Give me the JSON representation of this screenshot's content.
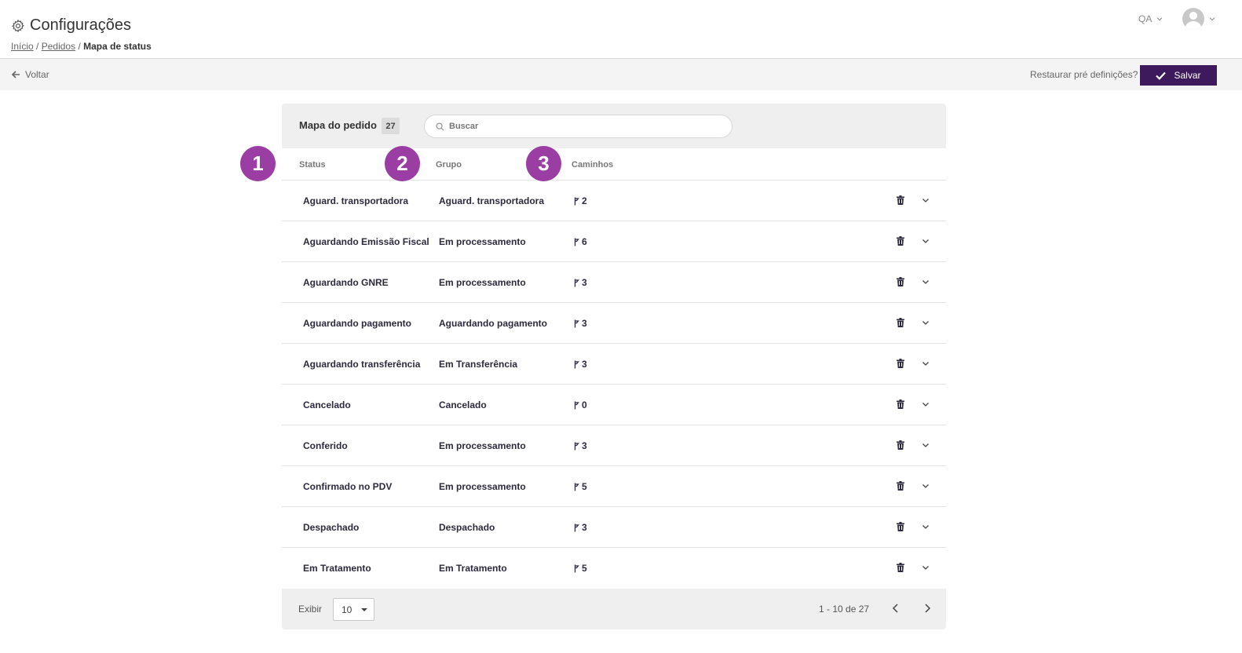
{
  "header": {
    "title": "Configurações",
    "breadcrumb": {
      "home": "Início",
      "orders": "Pedidos",
      "current": "Mapa de status",
      "sep": "/"
    },
    "env_label": "QA"
  },
  "toolbar": {
    "back_label": "Voltar",
    "restore_label": "Restaurar pré definições?",
    "save_label": "Salvar"
  },
  "card": {
    "title": "Mapa do pedido",
    "count": "27",
    "search_placeholder": "Buscar",
    "columns": {
      "status": "Status",
      "group": "Grupo",
      "paths": "Caminhos"
    },
    "rows": [
      {
        "status": "Aguard. transportadora",
        "group": "Aguard. transportadora",
        "paths": "2"
      },
      {
        "status": "Aguardando Emissão Fiscal",
        "group": "Em processamento",
        "paths": "6"
      },
      {
        "status": "Aguardando GNRE",
        "group": "Em processamento",
        "paths": "3"
      },
      {
        "status": "Aguardando pagamento",
        "group": "Aguardando pagamento",
        "paths": "3"
      },
      {
        "status": "Aguardando transferência",
        "group": "Em Transferência",
        "paths": "3"
      },
      {
        "status": "Cancelado",
        "group": "Cancelado",
        "paths": "0"
      },
      {
        "status": "Conferido",
        "group": "Em processamento",
        "paths": "3"
      },
      {
        "status": "Confirmado no PDV",
        "group": "Em processamento",
        "paths": "5"
      },
      {
        "status": "Despachado",
        "group": "Despachado",
        "paths": "3"
      },
      {
        "status": "Em Tratamento",
        "group": "Em Tratamento",
        "paths": "5"
      }
    ],
    "footer": {
      "show_label": "Exibir",
      "page_size": "10",
      "range": "1 - 10 de 27"
    }
  },
  "markers": [
    "1",
    "2",
    "3"
  ],
  "colors": {
    "accent": "#3d1a5b",
    "marker": "#9b3ea4"
  },
  "icons": {
    "paths": "route-icon",
    "delete": "trash-icon",
    "expand": "chevron-down-icon"
  }
}
